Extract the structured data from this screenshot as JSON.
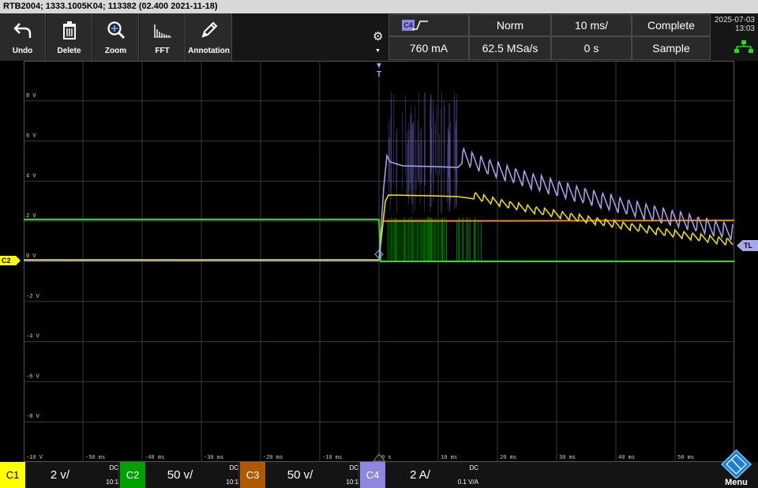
{
  "title": "RTB2004; 1333.1005K04; 113382 (02.400 2021-11-18)",
  "toolbar": {
    "undo": "Undo",
    "delete": "Delete",
    "zoom": "Zoom",
    "fft": "FFT",
    "annotation": "Annotation"
  },
  "trigger": {
    "source": "C4",
    "level": "760 mA",
    "mode": "Norm",
    "sample_rate": "62.5 MSa/s",
    "time_scale": "10 ms/",
    "position": "0 s",
    "acquisition": "Complete",
    "acq_mode": "Sample"
  },
  "datetime": {
    "date": "2025-07-03",
    "time": "13:03"
  },
  "y_labels": [
    "8 V",
    "6 V",
    "4 V",
    "2 V",
    "0 V",
    "-2 V",
    "-4 V",
    "-6 V",
    "-8 V",
    "-10 V"
  ],
  "x_labels": [
    "-50 ms",
    "-40 ms",
    "-30 ms",
    "-20 ms",
    "-10 ms",
    "0 s",
    "10 ms",
    "20 ms",
    "30 ms",
    "40 ms",
    "50 ms"
  ],
  "markers": {
    "c2": "C2",
    "tl": "TL",
    "trigger_top": "T"
  },
  "channels": [
    {
      "id": "C1",
      "scale": "2 v/",
      "coupling": "DC",
      "atten": "10:1",
      "color": "#ffff00"
    },
    {
      "id": "C2",
      "scale": "50 v/",
      "coupling": "DC",
      "atten": "10:1",
      "color": "#00a000"
    },
    {
      "id": "C3",
      "scale": "50 v/",
      "coupling": "DC",
      "atten": "10:1",
      "color": "#b05a00"
    },
    {
      "id": "C4",
      "scale": "2 A/",
      "coupling": "DC",
      "atten": "0.1 V/A",
      "color": "#8f86e0"
    }
  ],
  "menu": "Menu"
}
